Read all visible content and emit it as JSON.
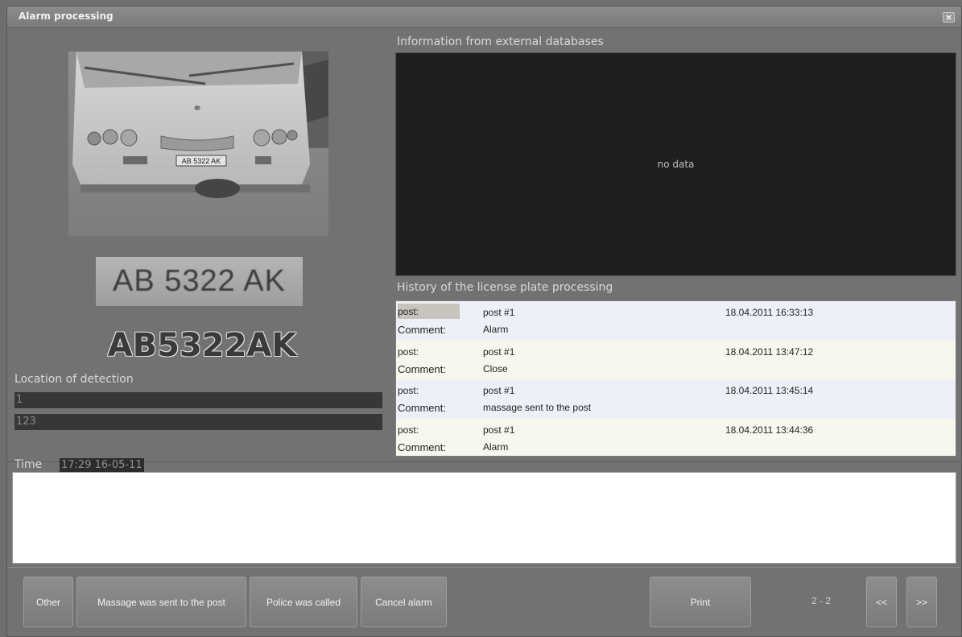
{
  "window": {
    "title": "Alarm processing",
    "close_icon": "close-icon"
  },
  "detection": {
    "plate_crop_text": "AB 5322 AK",
    "plate_on_vehicle": "AB 5322 AK",
    "plate_number": "AB5322AK",
    "location_label": "Location of detection",
    "location_line1": "1",
    "location_line2": "123",
    "time_label": "Time",
    "time_value": "17:29 16-05-11"
  },
  "external_db": {
    "label": "Information from external databases",
    "empty_text": "no data"
  },
  "history": {
    "label": "History of the license plate processing",
    "rows": [
      {
        "post_key": "post:",
        "post": "post #1",
        "datetime": "18.04.2011 16:33:13",
        "comment_key": "Comment:",
        "comment": "Alarm"
      },
      {
        "post_key": "post:",
        "post": "post #1",
        "datetime": "18.04.2011 13:47:12",
        "comment_key": "Comment:",
        "comment": "Close"
      },
      {
        "post_key": "post:",
        "post": "post #1",
        "datetime": "18.04.2011 13:45:14",
        "comment_key": "Comment:",
        "comment": "massage sent to the post"
      },
      {
        "post_key": "post:",
        "post": "post #1",
        "datetime": "18.04.2011 13:44:36",
        "comment_key": "Comment:",
        "comment": "Alarm"
      }
    ]
  },
  "comment_input": {
    "value": ""
  },
  "actions": {
    "other": "Other",
    "message_sent": "Massage was sent to the post",
    "police_called": "Police was called",
    "cancel_alarm": "Cancel alarm",
    "print": "Print",
    "page_indicator": "2 - 2",
    "prev": "<<",
    "next": ">>"
  },
  "colors": {
    "background": "#727272",
    "panel_dark": "#1f1f1f",
    "history_row_a": "#edf1f7",
    "history_row_b": "#f7f7ee"
  }
}
